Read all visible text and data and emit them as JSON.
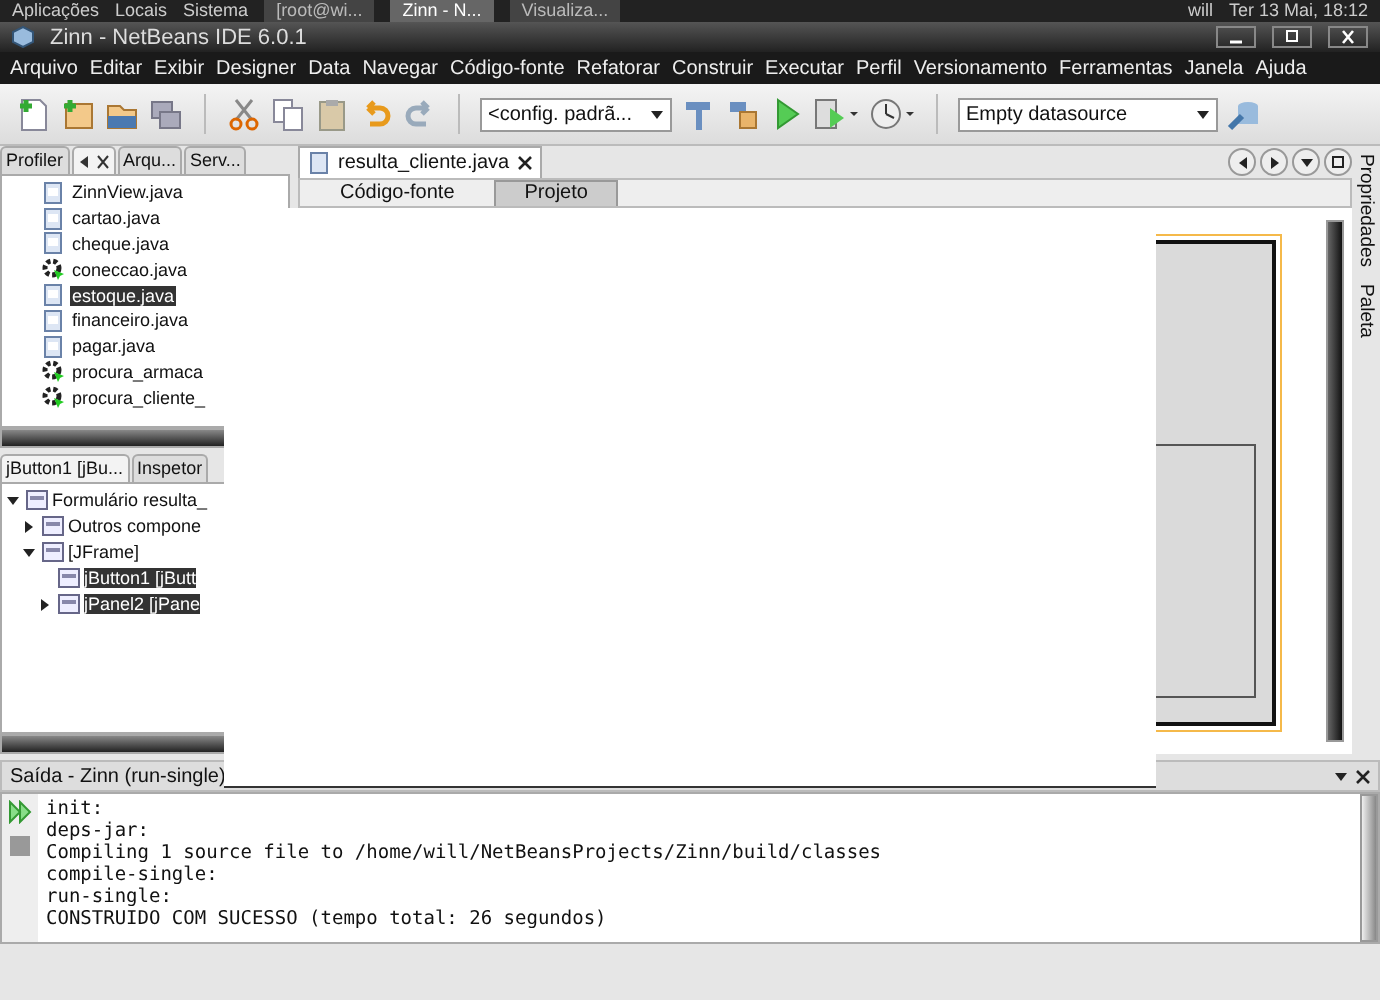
{
  "top_panel": {
    "menus": [
      "Aplicações",
      "Locais",
      "Sistema"
    ],
    "tasks": [
      {
        "label": "[root@wi...",
        "selected": false
      },
      {
        "label": "Zinn - N...",
        "selected": true
      },
      {
        "label": "Visualiza...",
        "selected": false
      }
    ],
    "user": "will",
    "clock": "Ter 13 Mai, 18:12"
  },
  "window": {
    "title": "Zinn - NetBeans IDE 6.0.1"
  },
  "menu": [
    "Arquivo",
    "Editar",
    "Exibir",
    "Designer",
    "Data",
    "Navegar",
    "Código-fonte",
    "Refatorar",
    "Construir",
    "Executar",
    "Perfil",
    "Versionamento",
    "Ferramentas",
    "Janela",
    "Ajuda"
  ],
  "toolbar": {
    "config": "<config. padrã...",
    "datasource": "Empty datasource"
  },
  "left_panel": {
    "tabs": [
      {
        "label": "Profiler",
        "selected": false
      },
      {
        "selected": true
      },
      {
        "label": "Arqu...",
        "selected": false
      },
      {
        "label": "Serv...",
        "selected": false
      }
    ],
    "files": [
      {
        "name": "ZinnView.java",
        "kind": "form",
        "selected": false
      },
      {
        "name": "cartao.java",
        "kind": "form",
        "selected": false
      },
      {
        "name": "cheque.java",
        "kind": "form",
        "selected": false
      },
      {
        "name": "coneccao.java",
        "kind": "main",
        "selected": false
      },
      {
        "name": "estoque.java",
        "kind": "form",
        "selected": true
      },
      {
        "name": "financeiro.java",
        "kind": "form",
        "selected": false
      },
      {
        "name": "pagar.java",
        "kind": "form",
        "selected": false
      },
      {
        "name": "procura_armaca",
        "kind": "main",
        "selected": false
      },
      {
        "name": "procura_cliente_",
        "kind": "main",
        "selected": false
      }
    ]
  },
  "inspector": {
    "tabs": [
      {
        "label": "jButton1 [jBu...",
        "selected": true
      },
      {
        "label": "Inspetor",
        "selected": false
      }
    ],
    "tree": [
      {
        "label": "Formulário resulta_",
        "expanded": true,
        "selected": false,
        "children": [
          {
            "label": "Outros compone",
            "expanded": false,
            "selected": false
          },
          {
            "label": "[JFrame]",
            "expanded": true,
            "selected": false,
            "children": [
              {
                "label": "jButton1 [jButt",
                "selected": true
              },
              {
                "label": "jPanel2 [jPane",
                "expanded": false,
                "selected": true
              }
            ]
          }
        ]
      }
    ]
  },
  "editor": {
    "tab": "resulta_cliente.java",
    "views": [
      {
        "label": "Código-fonte",
        "selected": false
      },
      {
        "label": "Projeto",
        "selected": true
      }
    ]
  },
  "right_strip": [
    "Propriedades",
    "Paleta"
  ],
  "output": {
    "title": "Saída - Zinn (run-single)",
    "lines": [
      "init:",
      "deps-jar:",
      "Compiling 1 source file to /home/will/NetBeansProjects/Zinn/build/classes",
      "compile-single:",
      "run-single:",
      "CONSTRUIDO COM SUCESSO (tempo total: 26 segundos)"
    ]
  }
}
